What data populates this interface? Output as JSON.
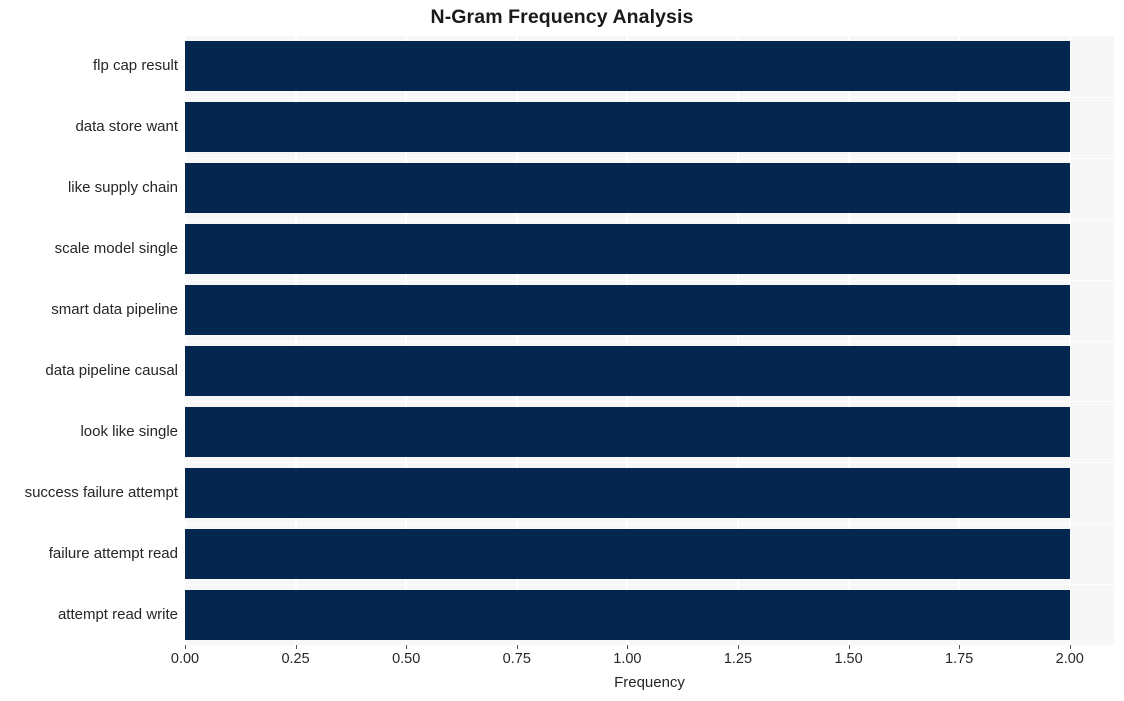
{
  "chart_data": {
    "type": "bar",
    "orientation": "horizontal",
    "title": "N-Gram Frequency Analysis",
    "xlabel": "Frequency",
    "ylabel": "",
    "categories": [
      "flp cap result",
      "data store want",
      "like supply chain",
      "scale model single",
      "smart data pipeline",
      "data pipeline causal",
      "look like single",
      "success failure attempt",
      "failure attempt read",
      "attempt read write"
    ],
    "values": [
      2,
      2,
      2,
      2,
      2,
      2,
      2,
      2,
      2,
      2
    ],
    "xlim": [
      0.0,
      2.1
    ],
    "xticks": [
      0.0,
      0.25,
      0.5,
      0.75,
      1.0,
      1.25,
      1.5,
      1.75,
      2.0
    ],
    "xtick_labels": [
      "0.00",
      "0.25",
      "0.50",
      "0.75",
      "1.00",
      "1.25",
      "1.50",
      "1.75",
      "2.00"
    ],
    "grid": true,
    "legend": null,
    "bar_color": "#04264f",
    "plot_background": "#f7f7f7",
    "grid_color": "#ffffff",
    "figure_background": "#ffffff",
    "text_color": "#262626"
  }
}
